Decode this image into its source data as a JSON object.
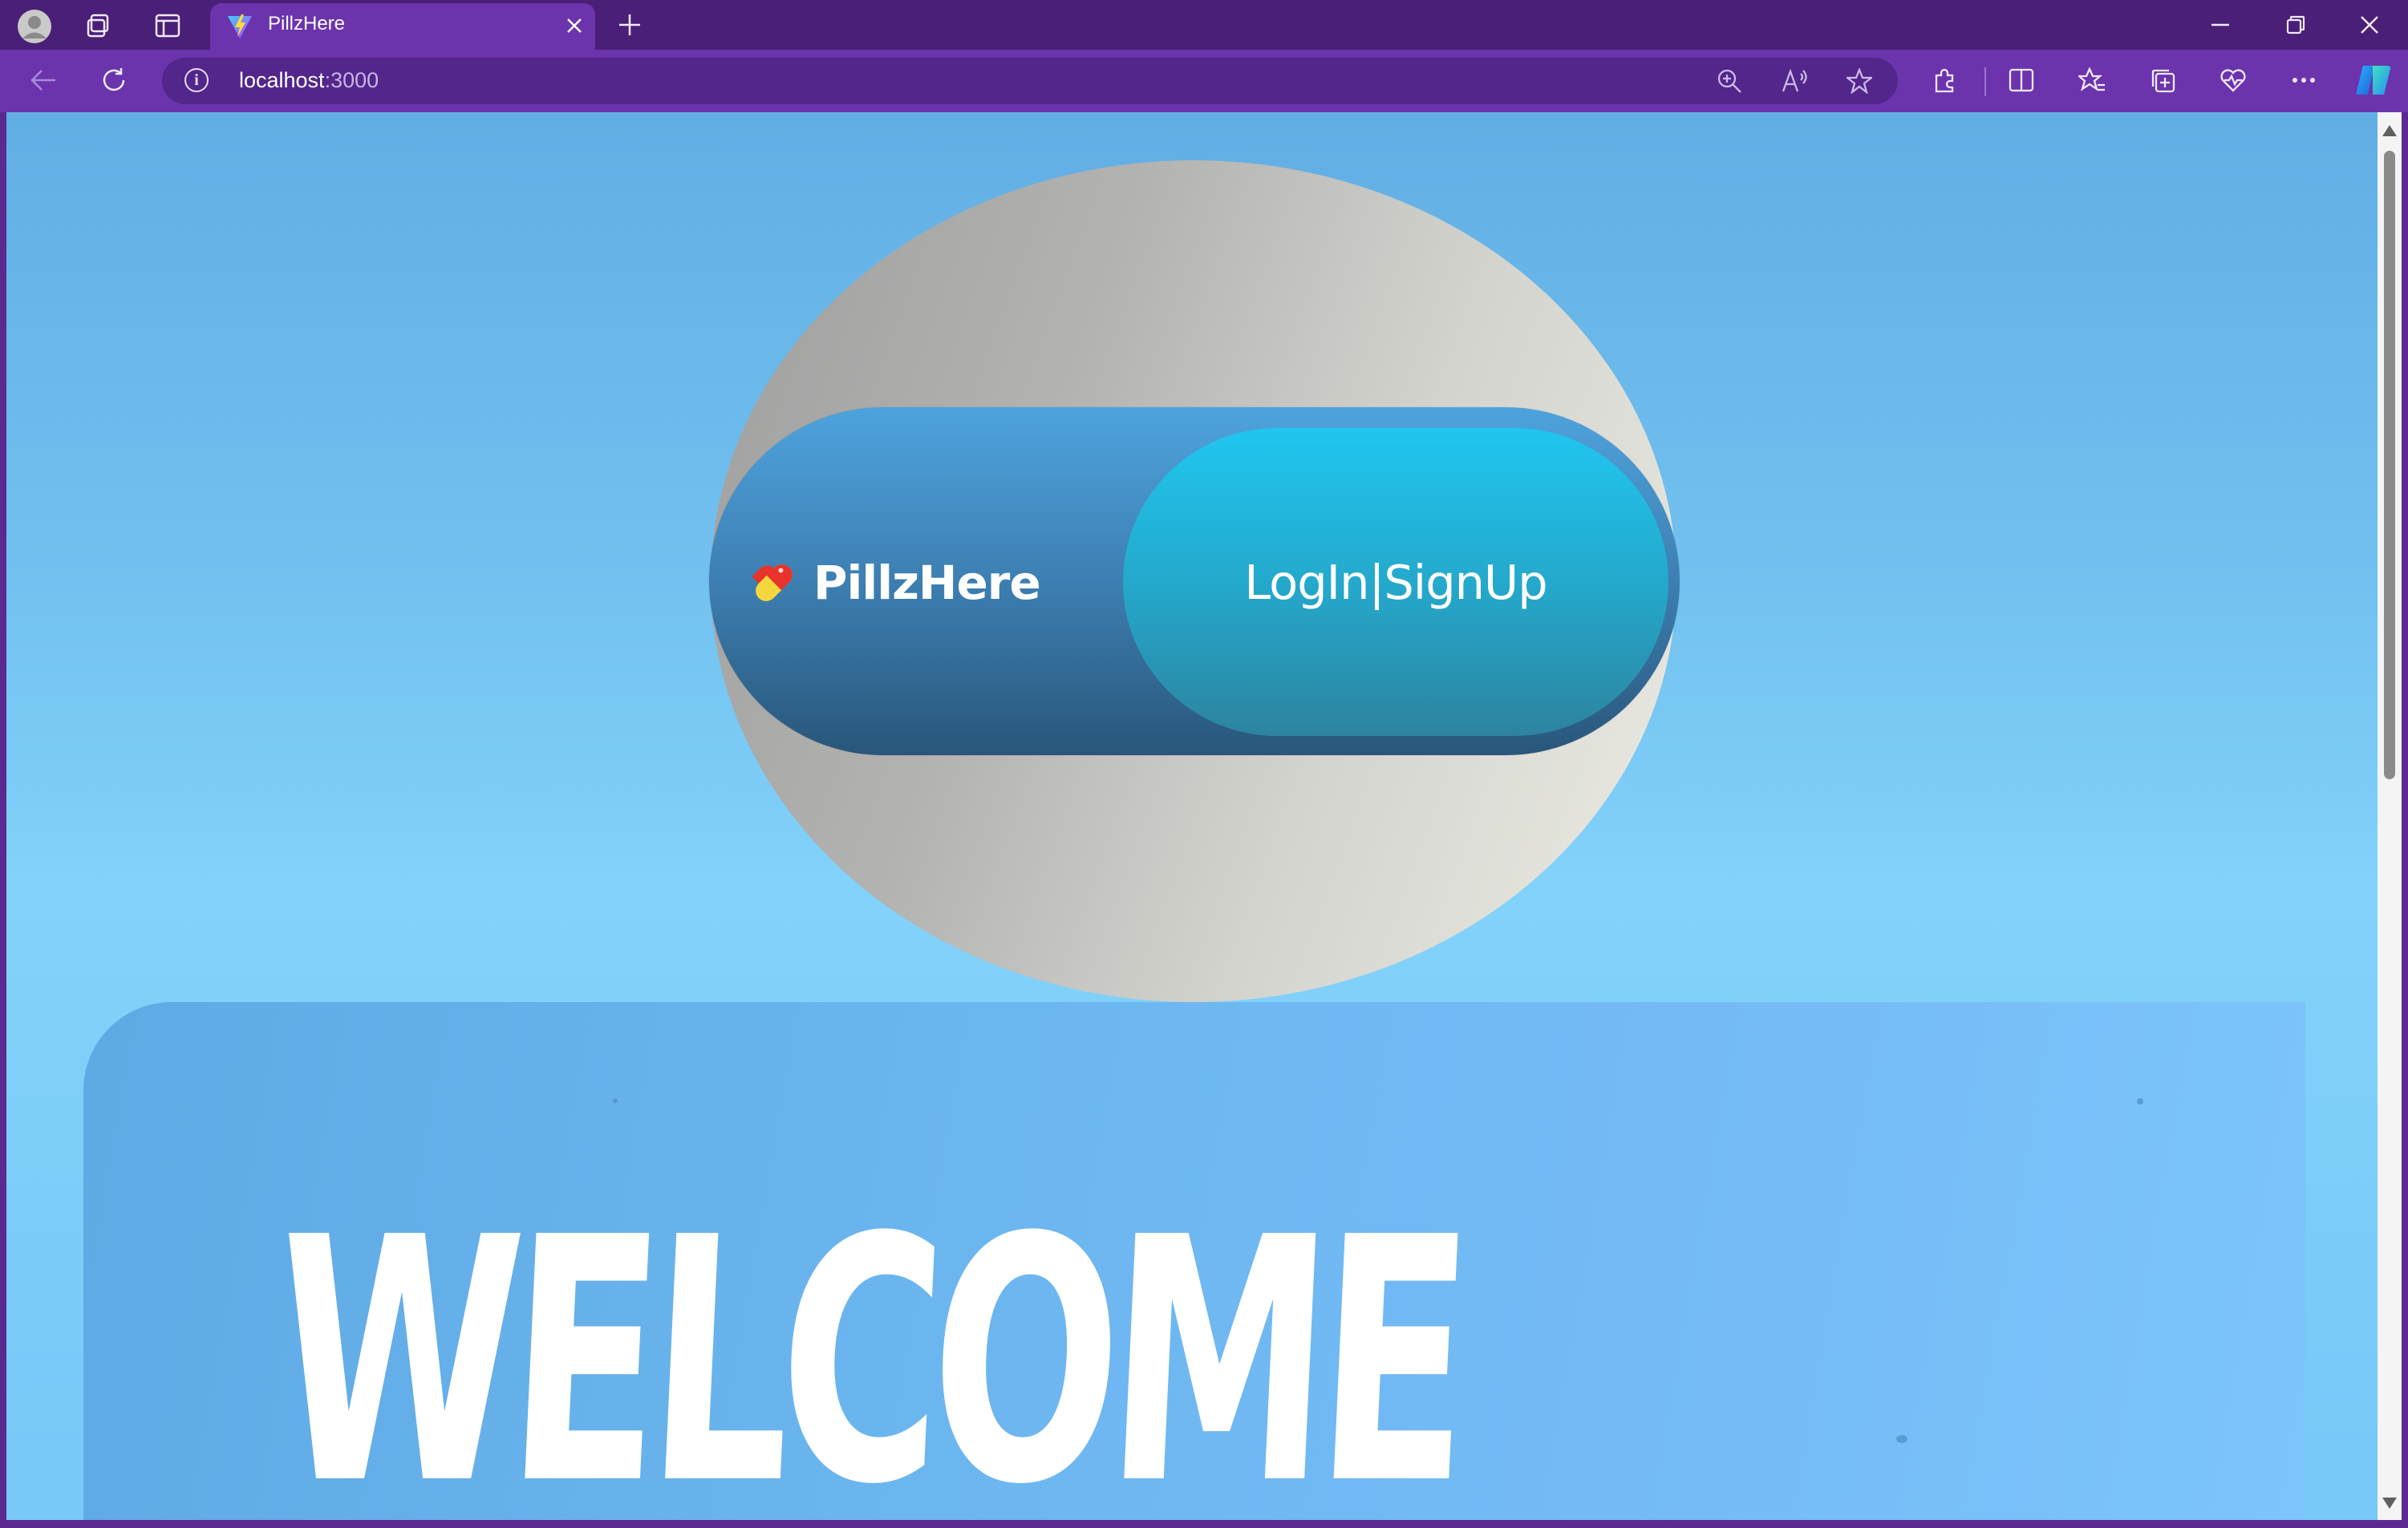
{
  "browser": {
    "tab": {
      "title": "PillzHere",
      "close_icon": "close-icon"
    },
    "new_tab_icon": "plus-icon",
    "window_controls": [
      "minimize-icon",
      "restore-icon",
      "close-icon"
    ],
    "address": {
      "host": "localhost",
      "port": ":3000",
      "info_icon": "info-icon",
      "info_glyph": "i"
    },
    "colors": {
      "frame": "#4a1f77",
      "toolbar": "#6b34ad",
      "address_bg": "#52268a"
    }
  },
  "page": {
    "brand": {
      "name": "PillzHere",
      "icon": "pill-icon"
    },
    "nav": {
      "login_signup": "LogIn|SignUp"
    },
    "hero": {
      "welcome": "WELCOME"
    },
    "colors": {
      "background": "#82d2fb",
      "pill_left": "#3d7fb2",
      "pill_right": "#20c6f0",
      "circle": "#d4d4cf"
    }
  }
}
